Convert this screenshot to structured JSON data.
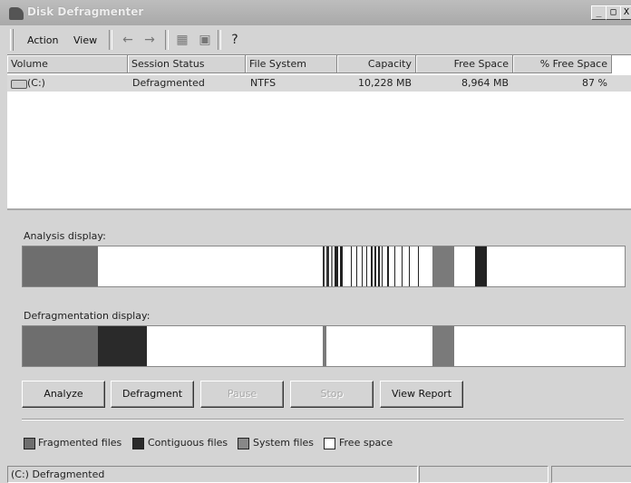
{
  "window": {
    "title": "Disk Defragmenter",
    "min_label": "_",
    "max_label": "□",
    "close_label": "X"
  },
  "menu": {
    "action": "Action",
    "view": "View"
  },
  "toolbar": {
    "back_icon": "←",
    "forward_icon": "→",
    "up_icon": "▦",
    "props_icon": "▣",
    "help_icon": "?"
  },
  "columns": [
    "Volume",
    "Session Status",
    "File System",
    "Capacity",
    "Free Space",
    "% Free Space"
  ],
  "volumes": [
    {
      "volume": "(C:)",
      "status": "Defragmented",
      "fs": "NTFS",
      "capacity": "10,228 MB",
      "free": "8,964 MB",
      "pct": "87 %"
    }
  ],
  "labels": {
    "analysis": "Analysis display:",
    "defrag": "Defragmentation display:"
  },
  "buttons": {
    "analyze": "Analyze",
    "defragment": "Defragment",
    "pause": "Pause",
    "stop": "Stop",
    "report": "View Report"
  },
  "legend": {
    "fragmented": "Fragmented files",
    "contiguous": "Contiguous files",
    "system": "System files",
    "free": "Free space"
  },
  "colors": {
    "fragmented": "#6e6e6e",
    "contiguous": "#2a2a2a",
    "system": "#888888",
    "free": "#ffffff"
  },
  "status": {
    "text": "(C:) Defragmented"
  }
}
